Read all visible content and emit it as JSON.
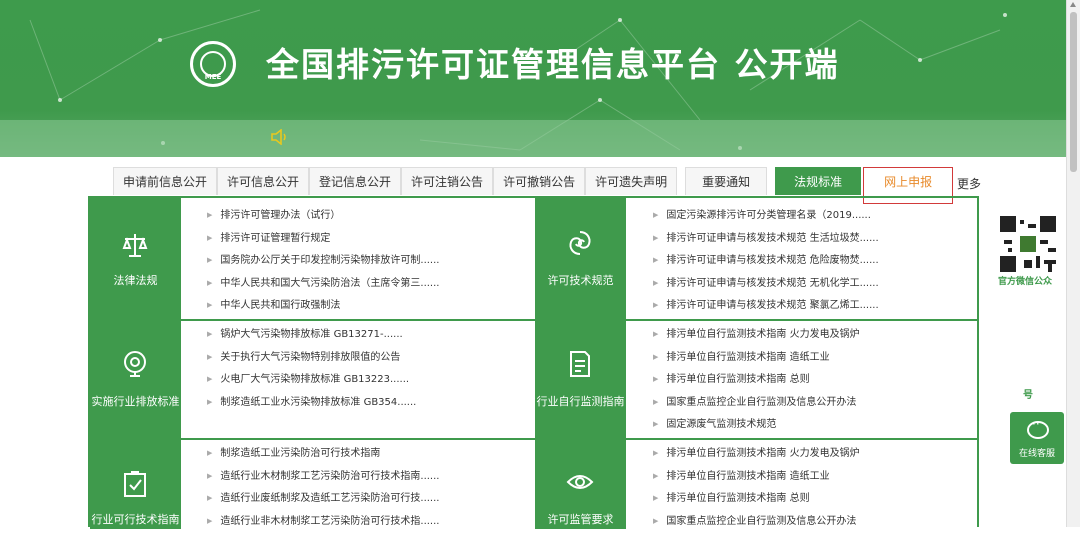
{
  "header": {
    "title": "全国排污许可证管理信息平台  公开端",
    "logo_text": "MEE"
  },
  "tabs": [
    {
      "label": "申请前信息公开"
    },
    {
      "label": "许可信息公开"
    },
    {
      "label": "登记信息公开"
    },
    {
      "label": "许可注销公告"
    },
    {
      "label": "许可撤销公告"
    },
    {
      "label": "许可遗失声明"
    },
    {
      "label": "重要通知"
    },
    {
      "label": "法规标准",
      "active": true
    },
    {
      "label": "网上申报",
      "highlighted": true
    }
  ],
  "more_label": "更多",
  "categories": {
    "law": {
      "label": "法律法规",
      "icon": "scales-icon",
      "items": [
        "排污许可管理办法（试行）",
        "排污许可证管理暂行规定",
        "国务院办公厅关于印发控制污染物排放许可制......",
        "中华人民共和国大气污染防治法（主席令第三......",
        "中华人民共和国行政强制法"
      ]
    },
    "permit_tech": {
      "label": "许可技术规范",
      "icon": "spiral-icon",
      "items": [
        "固定污染源排污许可分类管理名录（2019......",
        "排污许可证申请与核发技术规范 生活垃圾焚......",
        "排污许可证申请与核发技术规范 危险废物焚......",
        "排污许可证申请与核发技术规范 无机化学工......",
        "排污许可证申请与核发技术规范 聚氯乙烯工......"
      ]
    },
    "emission_std": {
      "label": "实施行业排放标准",
      "icon": "location-pin-icon",
      "items": [
        "锅炉大气污染物排放标准 GB13271-......",
        "关于执行大气污染物特别排放限值的公告",
        "火电厂大气污染物排放标准 GB13223......",
        "制浆造纸工业水污染物排放标准 GB354......"
      ]
    },
    "self_monitor": {
      "label": "行业自行监测指南",
      "icon": "document-icon",
      "items": [
        "排污单位自行监测技术指南 火力发电及锅炉",
        "排污单位自行监测技术指南 造纸工业",
        "排污单位自行监测技术指南 总则",
        "国家重点监控企业自行监测及信息公开办法",
        "固定源废气监测技术规范"
      ]
    },
    "feasible_tech": {
      "label": "行业可行技术指南",
      "icon": "checklist-icon",
      "items": [
        "制浆造纸工业污染防治可行技术指南",
        "造纸行业木材制浆工艺污染防治可行技术指南......",
        "造纸行业废纸制浆及造纸工艺污染防治可行技......",
        "造纸行业非木材制浆工艺污染防治可行技术指......"
      ]
    },
    "supervision": {
      "label": "许可监管要求",
      "icon": "eye-icon",
      "items": [
        "排污单位自行监测技术指南 火力发电及锅炉",
        "排污单位自行监测技术指南 造纸工业",
        "排污单位自行监测技术指南 总则",
        "国家重点监控企业自行监测及信息公开办法"
      ]
    }
  },
  "sidebar": {
    "qr_label": "官方微信公众",
    "number_label": "号",
    "service_label": "在线客服"
  },
  "colors": {
    "primary_green": "#3f9a4c",
    "highlight_border": "#d23a3a",
    "highlight_text": "#e88a2a"
  }
}
